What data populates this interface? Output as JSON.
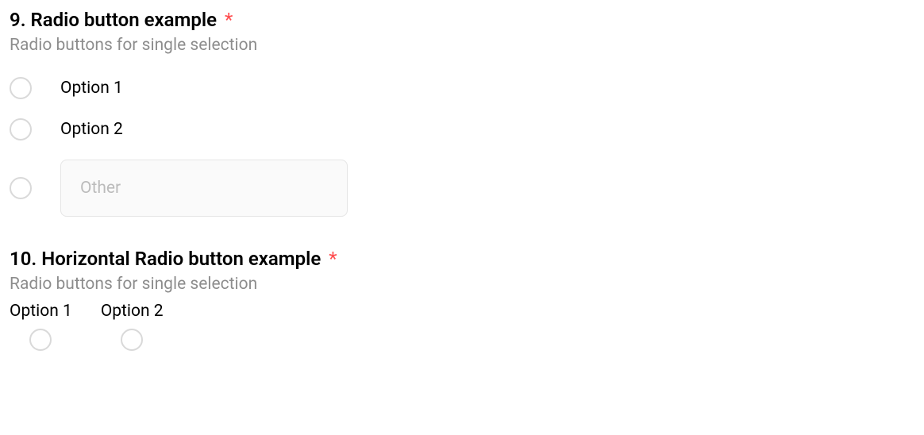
{
  "q9": {
    "number": "9.",
    "title": "Radio button example",
    "required_mark": "*",
    "description": "Radio buttons for single selection",
    "options": {
      "opt1": "Option 1",
      "opt2": "Option 2",
      "other_placeholder": "Other"
    }
  },
  "q10": {
    "number": "10.",
    "title": "Horizontal Radio button example",
    "required_mark": "*",
    "description": "Radio buttons for single selection",
    "options": {
      "opt1": "Option 1",
      "opt2": "Option 2"
    }
  }
}
